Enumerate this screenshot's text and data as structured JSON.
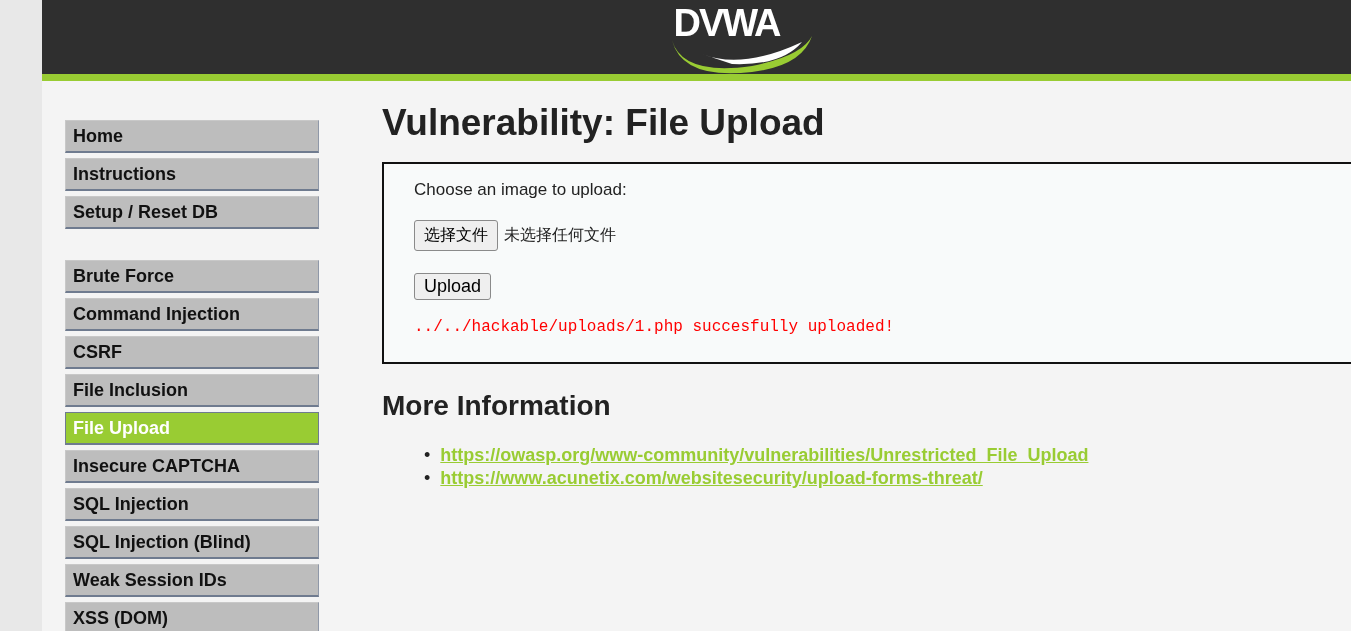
{
  "header": {
    "logo": "DVWA"
  },
  "menu_groups": [
    [
      {
        "label": "Home",
        "selected": false
      },
      {
        "label": "Instructions",
        "selected": false
      },
      {
        "label": "Setup / Reset DB",
        "selected": false
      }
    ],
    [
      {
        "label": "Brute Force",
        "selected": false
      },
      {
        "label": "Command Injection",
        "selected": false
      },
      {
        "label": "CSRF",
        "selected": false
      },
      {
        "label": "File Inclusion",
        "selected": false
      },
      {
        "label": "File Upload",
        "selected": true
      },
      {
        "label": "Insecure CAPTCHA",
        "selected": false
      },
      {
        "label": "SQL Injection",
        "selected": false
      },
      {
        "label": "SQL Injection (Blind)",
        "selected": false
      },
      {
        "label": "Weak Session IDs",
        "selected": false
      },
      {
        "label": "XSS (DOM)",
        "selected": false
      }
    ]
  ],
  "page_title": "Vulnerability: File Upload",
  "upload_form": {
    "prompt": "Choose an image to upload:",
    "file_button": "选择文件",
    "file_status": "未选择任何文件",
    "submit": "Upload",
    "message": "../../hackable/uploads/1.php succesfully uploaded!"
  },
  "more_info": {
    "heading": "More Information",
    "links": [
      {
        "bullet": "•",
        "url": "https://owasp.org/www-community/vulnerabilities/Unrestricted_File_Upload"
      },
      {
        "bullet": "•",
        "url": "https://www.acunetix.com/websitesecurity/upload-forms-threat/"
      }
    ]
  }
}
